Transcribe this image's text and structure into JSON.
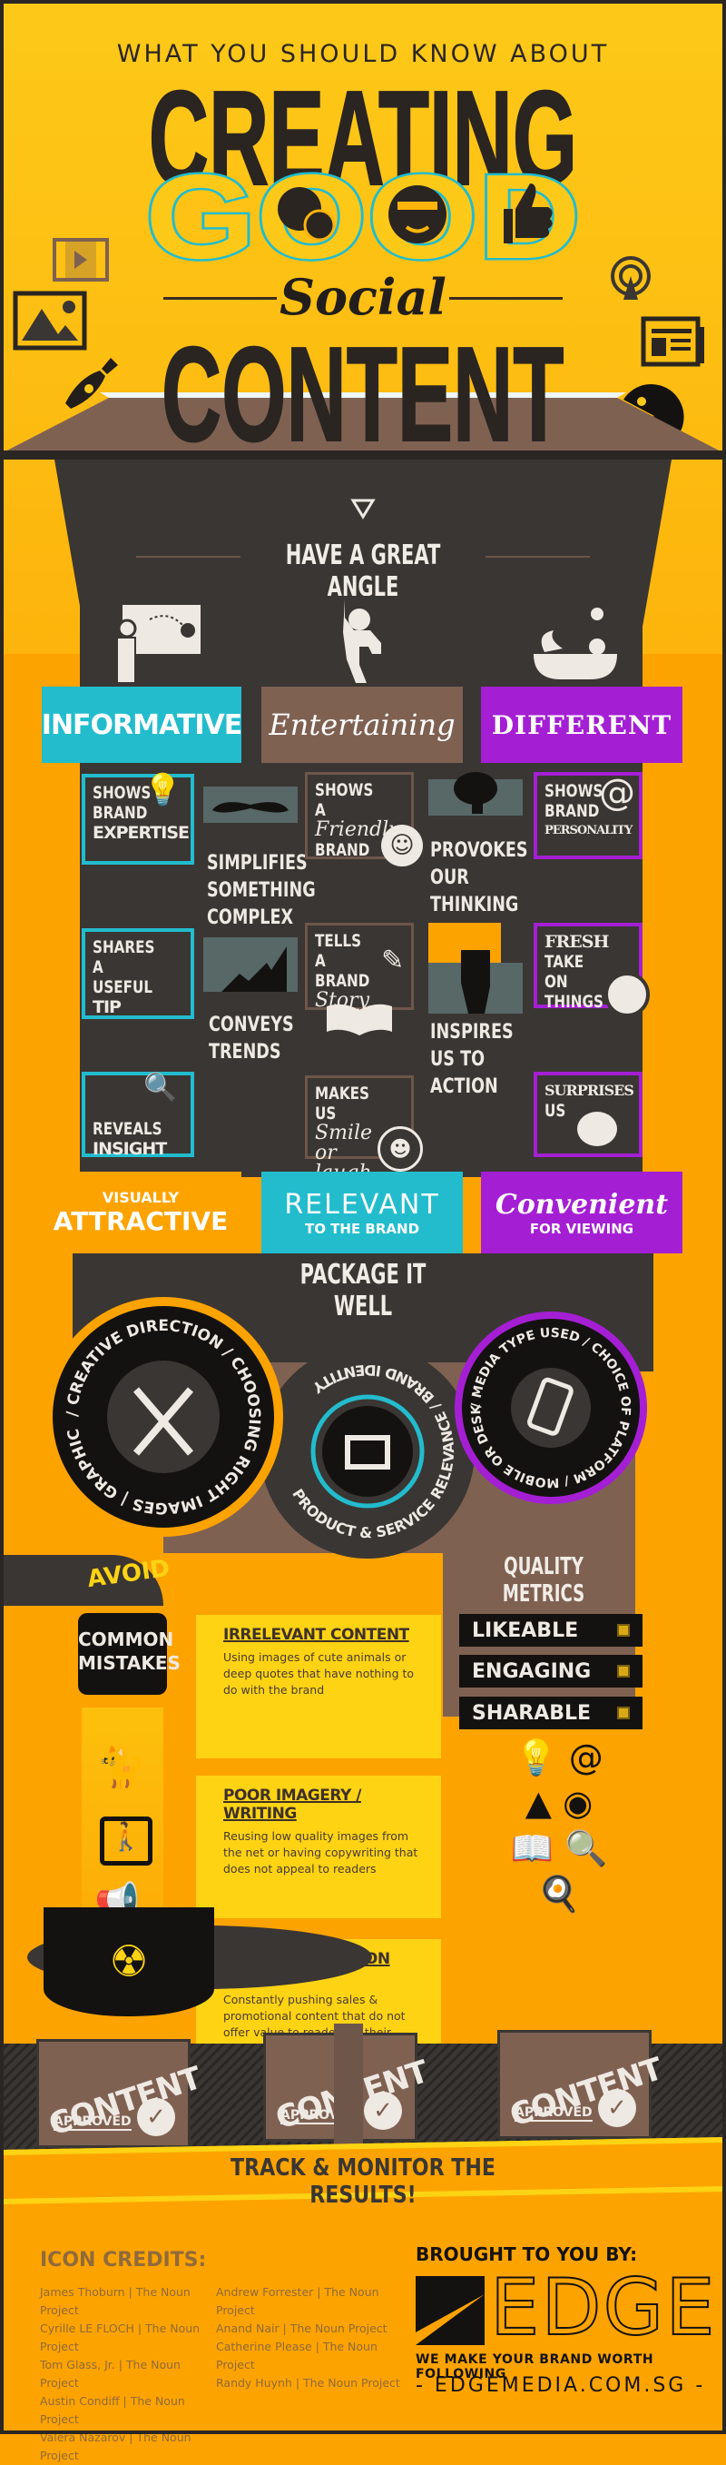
{
  "header": {
    "kicker": "WHAT YOU SHOULD KNOW ABOUT",
    "line1": "CREATING",
    "line2": "GOOD",
    "social": "Social",
    "line3": "CONTENT"
  },
  "angle": {
    "heading": "HAVE A GREAT ANGLE",
    "categories": [
      "INFORMATIVE",
      "Entertaining",
      "DIFFERENT"
    ]
  },
  "grid": {
    "c1": [
      {
        "a": "SHOWS BRAND",
        "b": "EXPERTISE"
      },
      {
        "a": "SHARES A USEFUL",
        "b": "TIP"
      },
      {
        "a": "REVEALS",
        "b": "INSIGHT"
      }
    ],
    "c2": [
      "SIMPLIFIES SOMETHING COMPLEX",
      "CONVEYS TRENDS"
    ],
    "c3": [
      {
        "a": "SHOWS A",
        "s": "Friendly",
        "b": "BRAND"
      },
      {
        "a": "TELLS A BRAND",
        "s": "Story"
      },
      {
        "a": "MAKES US",
        "s": "Smile or laugh"
      }
    ],
    "c4": [
      "PROVOKES OUR THINKING",
      "INSPIRES US TO ACTION"
    ],
    "c5": [
      {
        "a": "SHOWS BRAND",
        "b": "PERSONALITY"
      },
      {
        "b": "FRESH",
        "a": "TAKE ON THINGS"
      },
      {
        "b": "SURPRISES",
        "a": "US"
      }
    ]
  },
  "bottom_categories": [
    {
      "top": "VISUALLY",
      "main": "ATTRACTIVE"
    },
    {
      "main": "RELEVANT",
      "sub": "TO THE BRAND"
    },
    {
      "main": "Convenient",
      "sub": "FOR VIEWING"
    }
  ],
  "package": {
    "heading": "PACKAGE IT WELL",
    "left_gear": "/ CREATIVE DIRECTION / CHOOSING RIGHT IMAGES | GRAPHIC DESIGN |",
    "middle_gear": "PRODUCT & SERVICE RELEVANCE / BRAND IDENTITY",
    "right_gear": "/ MEDIA TYPE USED / CHOICE OF PLATFORM / MOBILE OR DESKTOP"
  },
  "mistakes": {
    "avoid": "AVOID",
    "label": "COMMON MISTAKES",
    "items": [
      {
        "title": "IRRELEVANT CONTENT",
        "body": "Using images of cute animals or deep quotes that have nothing to do with the brand"
      },
      {
        "title": "POOR IMAGERY / WRITING",
        "body": "Reusing low quality images from the net or having copywriting that does not appeal to readers"
      },
      {
        "title": "OVER EMPHASIS ON SALES",
        "body": "Constantly pushing  sales & promotional content that do not offer value to readers or their network"
      }
    ]
  },
  "metrics": {
    "title": "QUALITY METRICS",
    "items": [
      "LIKEABLE",
      "ENGAGING",
      "SHARABLE"
    ]
  },
  "crates": {
    "label": "CONTENT",
    "approved": "APPROVED"
  },
  "track": "TRACK & MONITOR THE RESULTS!",
  "credits": {
    "title": "ICON CREDITS:",
    "left": [
      "James Thoburn | The Noun Project",
      "Cyrille LE FLOCH | The Noun Project",
      "Tom Glass, Jr. | The Noun Project",
      "Austin Condiff | The Noun Project",
      "Valera Nazarov | The Noun Project"
    ],
    "right": [
      "Andrew Forrester | The Noun Project",
      "Anand Nair | The Noun Project",
      "Catherine Please | The Noun Project",
      "Randy Huynh | The Noun Project"
    ]
  },
  "brand": {
    "brought": "BROUGHT TO YOU BY:",
    "logo": "EDGE",
    "tagline": "WE MAKE YOUR BRAND WORTH FOLLOWING",
    "url": "- EDGEMEDIA.COM.SG -"
  },
  "colors": {
    "orange": "#fda300",
    "yellow": "#fdd314",
    "cyan": "#22bccd",
    "purple": "#a41fd3",
    "brown": "#7f6152",
    "dark": "#3a3633"
  }
}
